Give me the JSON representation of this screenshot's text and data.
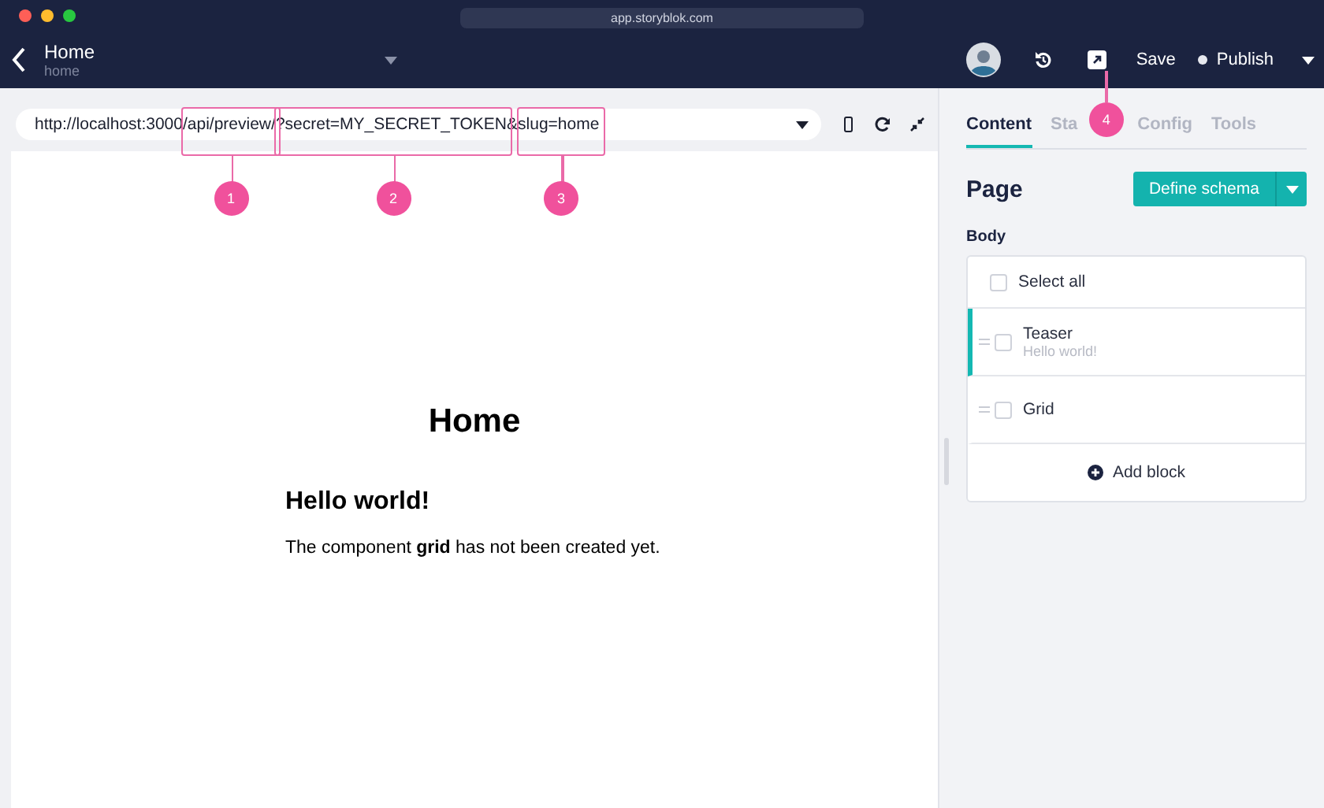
{
  "window": {
    "address": "app.storyblok.com"
  },
  "header": {
    "title": "Home",
    "subtitle": "home",
    "save": "Save",
    "publish": "Publish",
    "callout": "4"
  },
  "preview": {
    "url_parts": [
      {
        "text": "http://localhost:3000"
      },
      {
        "text": "/api/preview/",
        "callout": "1"
      },
      {
        "text": "?secret=MY_SECRET_TOKEN",
        "callout": "2"
      },
      {
        "text": "&"
      },
      {
        "text": "slug=home",
        "callout": "3"
      }
    ],
    "heading": "Home",
    "subheading": "Hello world!",
    "message": "The component **grid** has not been created yet."
  },
  "sidebar": {
    "tabs": [
      {
        "label": "Content",
        "selected": true
      },
      {
        "label": "Sta",
        "selected": false
      },
      {
        "label": "Config",
        "selected": false
      },
      {
        "label": "Tools",
        "selected": false
      }
    ],
    "title": "Page",
    "define_schema": "Define schema",
    "field_label": "Body",
    "select_all": {
      "label": "Select all",
      "checked": false
    },
    "blocks": [
      {
        "name": "Teaser",
        "preview": "Hello world!",
        "selected": true,
        "checked": false
      },
      {
        "name": "Grid",
        "selected": false,
        "checked": false
      }
    ],
    "add_block": "Add block"
  }
}
